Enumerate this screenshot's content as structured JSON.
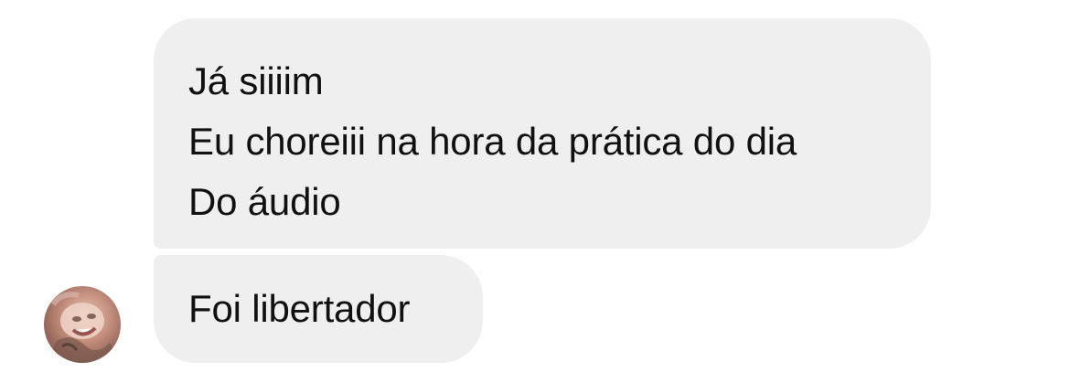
{
  "messages": [
    {
      "lines": [
        "Já siiiim",
        "Eu choreiii na hora da prática do dia",
        "Do áudio"
      ]
    },
    {
      "lines": [
        "Foi libertador"
      ]
    }
  ],
  "avatar": {
    "icon": "profile-photo"
  },
  "colors": {
    "bubble": "#efefef",
    "text": "#111111",
    "background": "#ffffff"
  }
}
